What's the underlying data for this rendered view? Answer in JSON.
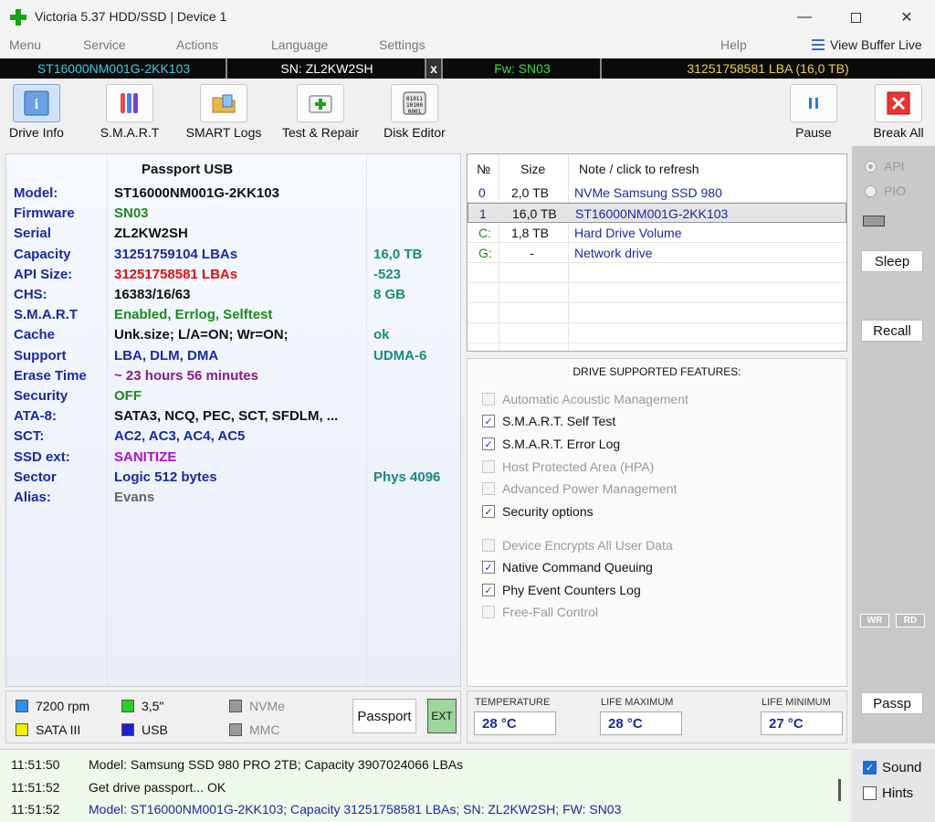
{
  "window": {
    "title": "Victoria 5.37 HDD/SSD | Device 1"
  },
  "menu": [
    "Menu",
    "Service",
    "Actions",
    "Language",
    "Settings",
    "Help"
  ],
  "view_buffer_label": "View Buffer Live",
  "infobar": {
    "model": "ST16000NM001G-2KK103",
    "serial": "SN: ZL2KW2SH",
    "close": "x",
    "firmware": "Fw: SN03",
    "lba": "31251758581 LBA (16,0 TB)"
  },
  "toolbar": {
    "drive_info": "Drive Info",
    "smart": "S.M.A.R.T",
    "smart_logs": "SMART Logs",
    "test_repair": "Test & Repair",
    "disk_editor": "Disk Editor",
    "pause": "Pause",
    "break_all": "Break All"
  },
  "passport": {
    "header": "Passport USB",
    "rows": [
      {
        "key": "Model:",
        "value": "ST16000NM001G-2KK103",
        "extra": "",
        "color": "#111"
      },
      {
        "key": "Firmware",
        "value": "SN03",
        "extra": "",
        "color": "#1e8a1e"
      },
      {
        "key": "Serial",
        "value": "ZL2KW2SH",
        "extra": "",
        "color": "#111"
      },
      {
        "key": "Capacity",
        "value": "31251759104 LBAs",
        "extra": "16,0 TB",
        "color": "#1a2aa0"
      },
      {
        "key": "API Size:",
        "value": "31251758581 LBAs",
        "extra": "-523",
        "color": "#e01010"
      },
      {
        "key": "CHS:",
        "value": "16383/16/63",
        "extra": "8 GB",
        "color": "#111"
      },
      {
        "key": "S.M.A.R.T",
        "value": "Enabled, Errlog, Selftest",
        "extra": "",
        "color": "#1e8a1e"
      },
      {
        "key": "Cache",
        "value": "Unk.size; L/A=ON; Wr=ON;",
        "extra": "ok",
        "color": "#111"
      },
      {
        "key": "Support",
        "value": "LBA, DLM, DMA",
        "extra": "UDMA-6",
        "color": "#1a2aa0"
      },
      {
        "key": "Erase Time",
        "value": "~ 23 hours 56 minutes",
        "extra": "",
        "color": "#8a1a8a"
      },
      {
        "key": "Security",
        "value": "OFF",
        "extra": "",
        "color": "#1e8a1e"
      },
      {
        "key": "ATA-8:",
        "value": "SATA3, NCQ, PEC, SCT, SFDLM, ...",
        "extra": "",
        "color": "#111"
      },
      {
        "key": "SCT:",
        "value": "AC2, AC3, AC4, AC5",
        "extra": "",
        "color": "#1a2aa0"
      },
      {
        "key": "SSD ext:",
        "value": "SANITIZE",
        "extra": "",
        "color": "#b010d0"
      },
      {
        "key": "Sector",
        "value": "Logic 512 bytes",
        "extra": "Phys 4096",
        "color": "#1a2aa0"
      },
      {
        "key": "Alias:",
        "value": "Evans",
        "extra": "",
        "color": "#666"
      }
    ]
  },
  "drivelist": {
    "headers": {
      "num": "№",
      "size": "Size",
      "note": "Note / click to refresh"
    },
    "rows": [
      {
        "num": "0",
        "size": "2,0 TB",
        "note": "NVMe     Samsung SSD 980",
        "numcolor": "#1a2aa0",
        "notecolor": "#1a2aa0"
      },
      {
        "num": "1",
        "size": "16,0 TB",
        "note": "ST16000NM001G-2KK103",
        "numcolor": "#1a2aa0",
        "notecolor": "#1a2aa0"
      },
      {
        "num": "C:",
        "size": "1,8 TB",
        "note": "Hard Drive Volume",
        "numcolor": "#1e8a1e",
        "notecolor": "#1a2aa0"
      },
      {
        "num": "G:",
        "size": "-",
        "note": "Network drive",
        "numcolor": "#1e8a1e",
        "notecolor": "#1a2aa0"
      }
    ]
  },
  "features": {
    "title": "DRIVE SUPPORTED FEATURES:",
    "items": [
      {
        "label": "Automatic Acoustic Management",
        "checked": false
      },
      {
        "label": "S.M.A.R.T. Self Test",
        "checked": true
      },
      {
        "label": "S.M.A.R.T. Error Log",
        "checked": true
      },
      {
        "label": "Host Protected Area (HPA)",
        "checked": false
      },
      {
        "label": "Advanced Power Management",
        "checked": false
      },
      {
        "label": "Security options",
        "checked": true
      },
      {
        "label": "Device Encrypts All User Data",
        "checked": false
      },
      {
        "label": "Native Command Queuing",
        "checked": true
      },
      {
        "label": "Phy Event Counters Log",
        "checked": true
      },
      {
        "label": "Free-Fall Control",
        "checked": false
      }
    ]
  },
  "right": {
    "api": "API",
    "pio": "PIO",
    "sleep": "Sleep",
    "recall": "Recall",
    "wr": "WR",
    "rd": "RD",
    "passp": "Passp"
  },
  "legend": {
    "rpm": "7200 rpm",
    "form": "3,5\"",
    "nvme": "NVMe",
    "sata": "SATA III",
    "usb": "USB",
    "mmc": "MMC",
    "passport": "Passport",
    "ext": "EXT"
  },
  "temps": {
    "temp_label": "TEMPERATURE",
    "temp": "28 °C",
    "lmax_label": "LIFE MAXIMUM",
    "lmax": "28 °C",
    "lmin_label": "LIFE MINIMUM",
    "lmin": "27 °C"
  },
  "log": [
    {
      "time": "11:51:50",
      "msg": "Model: Samsung SSD 980 PRO 2TB; Capacity 3907024066 LBAs",
      "color": "#111"
    },
    {
      "time": "11:51:52",
      "msg": "Get drive passport... OK",
      "color": "#111"
    },
    {
      "time": "11:51:52",
      "msg": "Model: ST16000NM001G-2KK103; Capacity 31251758581 LBAs; SN: ZL2KW2SH; FW: SN03",
      "color": "#1a2aa0"
    }
  ],
  "options": {
    "sound": "Sound",
    "sound_checked": true,
    "hints": "Hints",
    "hints_checked": false
  }
}
